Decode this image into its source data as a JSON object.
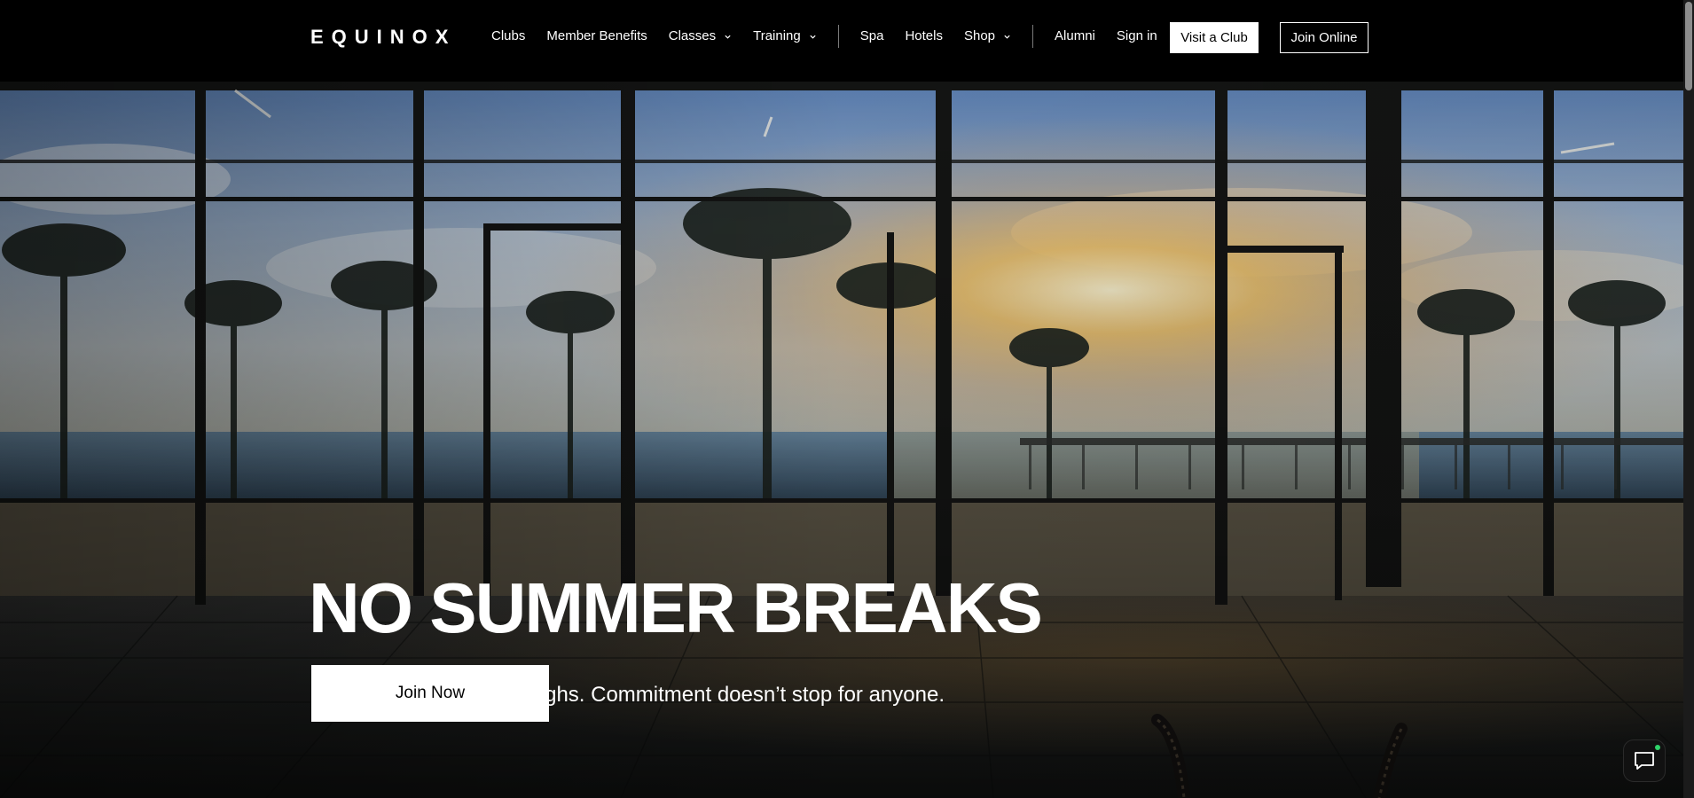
{
  "nav": {
    "logo": "EQUINOX",
    "links": [
      {
        "label": "Clubs"
      },
      {
        "label": "Member Benefits"
      },
      {
        "label": "Classes"
      },
      {
        "label": "Training"
      },
      {
        "label": "Spa"
      },
      {
        "label": "Hotels"
      },
      {
        "label": "Shop"
      },
      {
        "label": "Alumni"
      },
      {
        "label": "Sign in"
      }
    ],
    "visit_label": "Visit a Club",
    "join_online_label": "Join Online"
  },
  "hero": {
    "title": "NO SUMMER BREAKS",
    "subtitle": "Only summer breakthroughs. Commitment doesn’t stop for anyone.",
    "cta_label": "Join Now"
  },
  "icons": {
    "dropdown": "chevron-down-icon",
    "chat": "chat-bubble-icon"
  },
  "colors": {
    "nav_background": "#000000",
    "nav_text": "#ffffff",
    "cta_background": "#ffffff",
    "cta_text": "#000000",
    "chat_status": "#2fd36a"
  }
}
